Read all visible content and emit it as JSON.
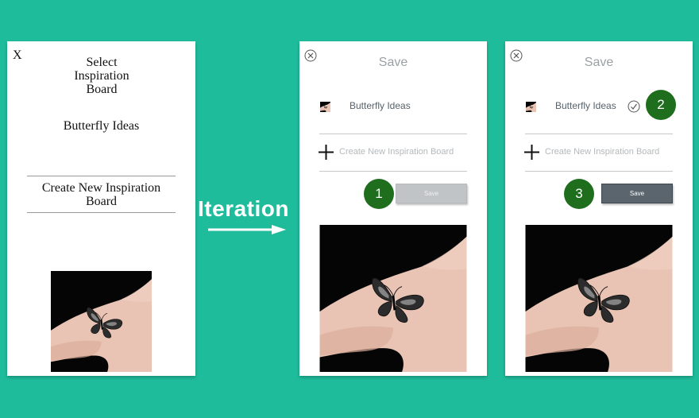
{
  "old_panel": {
    "close_label": "X",
    "title": "Select\nInspiration\nBoard",
    "board_name": "Butterfly Ideas",
    "create_label": "Create New Inspiration\nBoard"
  },
  "iteration_label": "Iteration",
  "panel_1": {
    "title": "Save",
    "board_name": "Butterfly Ideas",
    "create_label": "Create New Inspiration Board",
    "save_label": "Save",
    "badge": "1"
  },
  "panel_2": {
    "title": "Save",
    "board_name": "Butterfly Ideas",
    "create_label": "Create New Inspiration Board",
    "save_label": "Save",
    "badge_check": "2",
    "badge_save": "3"
  },
  "colors": {
    "background": "#1fbc9c",
    "badge": "#1e6e1e",
    "save_disabled": "#c1c4c6",
    "save_active": "#5a656d"
  }
}
